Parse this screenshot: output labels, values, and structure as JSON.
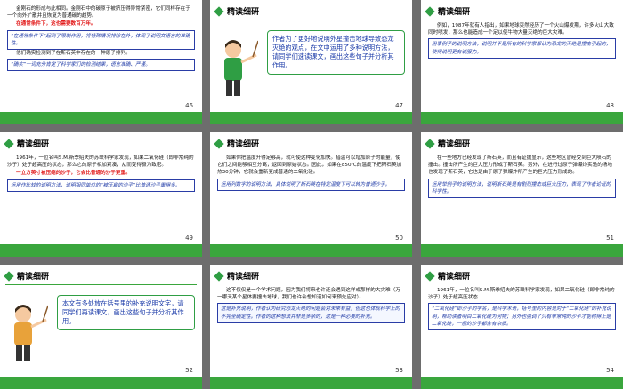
{
  "header": "精读细研",
  "slides": [
    {
      "num": "46",
      "paras": [
        "金刚石的形成与此相同。金刚石中的碳原子被挤压得异常紧密，它们同样存在于一个向外扩散并且恢复为普通碳的趋势。",
        "在通常条件下，这也需要数百万年。",
        "“在通常条件下”起到了限制作用，将特殊情况排除在外，体现了说明文语言的准确性。",
        "他们确实检测到了在斯石英中存在的一种原子排列。",
        "“确实”一词充分肯定了科学家们的检测结果，语言准确、严谨。"
      ]
    },
    {
      "num": "47",
      "bubble": "作者为了更好地说明外星撞击地球导致恐龙灭绝的观点，在文中运用了多种说明方法，请同学们速读课文，画出这些句子并分析其作用。"
    },
    {
      "num": "48",
      "paras": [
        "例如，1987年就有人指出，如果地球突然经历了一个火山爆发期，许多火山大致同时喷发，那么也能造成一个足以使牛物大量灭绝的巨大灾难。",
        "用事例子的说明方法，说明并不是所有的科学家都认为恐龙的灭绝是撞击引起的，使得说明更有说服力。"
      ]
    },
    {
      "num": "49",
      "paras": [
        "1961年，一位名叫S.M.斯季绍夫的苏联科学家发现，如果二氧化硅（即非常纯的沙子）处于超高压的状态，那么它的原子相加紧凑，从而变得极为致密。",
        "一立方英寸被压缩的沙子，它会比普通的沙子更重。",
        "运用作比较的说明方法，说明相同单位的“被压扁的沙子”比普通沙子重得多。"
      ]
    },
    {
      "num": "50",
      "paras": [
        "如果你把温度升得足够高，就可使这种变化加快。措温可以增加原子的能量，使它们之间能够相互分离，返回到原始状态。因此，如果在850℃的温度下把斯石英加热30分钟，它就会重新变成普通的二氧化硅。",
        "运用列数字的说明方法，具体说明了斯石英在特定温度下可以转为普通沙子。"
      ]
    },
    {
      "num": "51",
      "paras": [
        "在一些地方已经发现了斯石英，而且有证据显示，这些地区曾经受到巨大陨石的撞击。撞击所产生的巨大压力形成了斯石英。另外，在进行过原子弹爆炸实验的场地也发现了斯石英，它也是由于原子弹爆炸所产生的巨大压力形成的。",
        "运用举例子的说明方法，说明斯石英是有剧烈撞击或巨大压力，表现了作者论证的科学性。"
      ]
    },
    {
      "num": "52",
      "bubble": "本文有多处放在括号里的补充说明文字，请同学们再读课文，画出这些句子并分析其作用。"
    },
    {
      "num": "53",
      "paras": [
        "这不仅仅是一个学术问题，因为我们将来也许还会遇到这样或那样的大灾难（万一哪天某个星体要撞击地球，我们也许会想知道如何来预先应对）。",
        "这是补充说明，作者认为研究恐龙灭绝的问题会对未来有益，但这也体现科学上的不完全确定性。作者的这种想法并非是多余的，这是一种必要的补充。"
      ]
    },
    {
      "num": "54",
      "paras": [
        "1961年，一位名叫S.M.斯季绍夫的苏联科学家发现，如果二氧化硅（即非常纯的沙子）处于超高压状态……",
        "“二氧化硅”即沙子的学名，是科学术语，括号里的内容是对于“二氧化硅”的补充说明，帮助读者明白二氧化硅为何物；另外也强调了只有非常纯的沙子才能称得上是二氧化硅，一般的沙子都含有杂质。"
      ]
    }
  ]
}
